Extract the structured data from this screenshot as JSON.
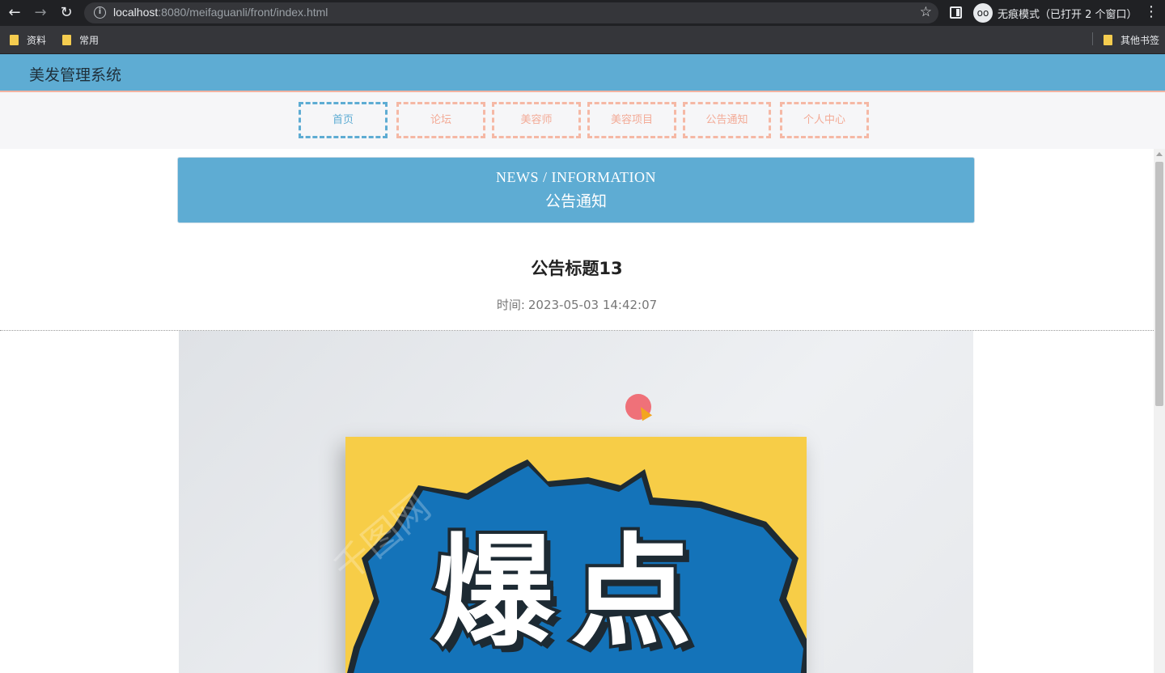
{
  "browser": {
    "url_host": "localhost",
    "url_rest": ":8080/meifaguanli/front/index.html",
    "incognito_label": "无痕模式（已打开 2 个窗口）",
    "bookmarks": [
      "资料",
      "常用"
    ],
    "other_bookmarks": "其他书签"
  },
  "site": {
    "title": "美发管理系统",
    "nav": [
      "首页",
      "论坛",
      "美容师",
      "美容项目",
      "公告通知",
      "个人中心"
    ],
    "active_nav": "首页"
  },
  "banner": {
    "en": "NEWS / INFORMATION",
    "cn": "公告通知"
  },
  "article": {
    "title": "公告标题13",
    "time_label": "时间:",
    "time_value": "2023-05-03 14:42:07",
    "image_text": "爆点"
  },
  "colors": {
    "header": "#5eacd3",
    "nav_border": "#f5b8a5",
    "poster_bg": "#f7cd47",
    "poster_burst": "#1473b9"
  }
}
